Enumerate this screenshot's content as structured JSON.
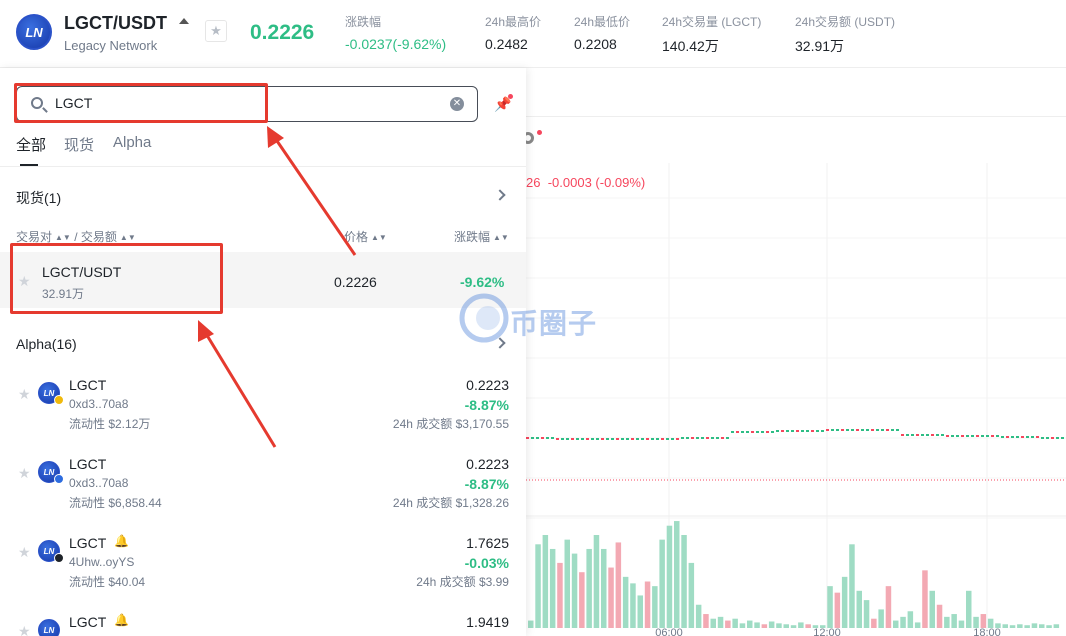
{
  "header": {
    "logo_text": "LN",
    "pair": "LGCT/USDT",
    "project": "Legacy Network",
    "price": "0.2226",
    "stats": [
      {
        "label": "涨跌幅",
        "value": "-0.0237(-9.62%)",
        "green": true
      },
      {
        "label": "24h最高价",
        "value": "0.2482"
      },
      {
        "label": "24h最低价",
        "value": "0.2208"
      },
      {
        "label": "24h交易量 (LGCT)",
        "value": "140.42万"
      },
      {
        "label": "24h交易额 (USDT)",
        "value": "32.91万"
      }
    ]
  },
  "search": {
    "value": "LGCT",
    "clear_icon": "clear-icon"
  },
  "tabs": [
    {
      "label": "全部",
      "active": true
    },
    {
      "label": "现货",
      "active": false
    },
    {
      "label": "Alpha",
      "active": false
    }
  ],
  "spot_section": {
    "title": "现货(1)"
  },
  "columns": {
    "pair": "交易对",
    "sep": "/",
    "volume": "交易额",
    "price": "价格",
    "change": "涨跌幅"
  },
  "spot_row": {
    "pair": "LGCT/USDT",
    "volume": "32.91万",
    "price": "0.2226",
    "change": "-9.62%"
  },
  "alpha_section": {
    "title": "Alpha(16)"
  },
  "alpha_rows": [
    {
      "name": "LGCT",
      "addr": "0xd3..70a8",
      "liquidity": "流动性 $2.12万",
      "price": "0.2223",
      "change": "-8.87%",
      "vol": "24h 成交额 $3,170.55",
      "chain_color": "#f0b90b",
      "bell": false
    },
    {
      "name": "LGCT",
      "addr": "0xd3..70a8",
      "liquidity": "流动性 $6,858.44",
      "price": "0.2223",
      "change": "-8.87%",
      "vol": "24h 成交额 $1,328.26",
      "chain_color": "#2d6cdf",
      "bell": false
    },
    {
      "name": "LGCT",
      "addr": "4Uhw..oyYS",
      "liquidity": "流动性 $40.04",
      "price": "1.7625",
      "change": "-0.03%",
      "vol": "24h 成交额 $3.99",
      "chain_color": "#1e2329",
      "bell": true
    },
    {
      "name": "LGCT",
      "addr": "",
      "liquidity": "",
      "price": "1.9419",
      "change": "",
      "vol": "",
      "chain_color": "#1e2329",
      "bell": true
    }
  ],
  "chart": {
    "ohlc_prefix": "26",
    "ohlc_change": "-0.0003 (-0.09%)",
    "time_labels": [
      "06:00",
      "12:00",
      "18:00"
    ],
    "watermark": "币圈子",
    "volume_bars": [
      {
        "v": 8,
        "up": true
      },
      {
        "v": 90,
        "up": true
      },
      {
        "v": 100,
        "up": true
      },
      {
        "v": 85,
        "up": true
      },
      {
        "v": 70,
        "up": false
      },
      {
        "v": 95,
        "up": true
      },
      {
        "v": 80,
        "up": true
      },
      {
        "v": 60,
        "up": false
      },
      {
        "v": 85,
        "up": true
      },
      {
        "v": 100,
        "up": true
      },
      {
        "v": 85,
        "up": true
      },
      {
        "v": 65,
        "up": false
      },
      {
        "v": 92,
        "up": false
      },
      {
        "v": 55,
        "up": true
      },
      {
        "v": 48,
        "up": true
      },
      {
        "v": 35,
        "up": true
      },
      {
        "v": 50,
        "up": false
      },
      {
        "v": 45,
        "up": true
      },
      {
        "v": 95,
        "up": true
      },
      {
        "v": 110,
        "up": true
      },
      {
        "v": 115,
        "up": true
      },
      {
        "v": 100,
        "up": true
      },
      {
        "v": 70,
        "up": true
      },
      {
        "v": 25,
        "up": true
      },
      {
        "v": 15,
        "up": false
      },
      {
        "v": 10,
        "up": true
      },
      {
        "v": 12,
        "up": true
      },
      {
        "v": 8,
        "up": false
      },
      {
        "v": 10,
        "up": true
      },
      {
        "v": 5,
        "up": true
      },
      {
        "v": 8,
        "up": true
      },
      {
        "v": 6,
        "up": true
      },
      {
        "v": 4,
        "up": false
      },
      {
        "v": 7,
        "up": true
      },
      {
        "v": 5,
        "up": true
      },
      {
        "v": 4,
        "up": true
      },
      {
        "v": 3,
        "up": true
      },
      {
        "v": 6,
        "up": true
      },
      {
        "v": 4,
        "up": false
      },
      {
        "v": 3,
        "up": true
      },
      {
        "v": 3,
        "up": true
      },
      {
        "v": 45,
        "up": true
      },
      {
        "v": 38,
        "up": false
      },
      {
        "v": 55,
        "up": true
      },
      {
        "v": 90,
        "up": true
      },
      {
        "v": 40,
        "up": true
      },
      {
        "v": 30,
        "up": true
      },
      {
        "v": 10,
        "up": false
      },
      {
        "v": 20,
        "up": true
      },
      {
        "v": 45,
        "up": false
      },
      {
        "v": 8,
        "up": true
      },
      {
        "v": 12,
        "up": true
      },
      {
        "v": 18,
        "up": true
      },
      {
        "v": 6,
        "up": true
      },
      {
        "v": 62,
        "up": false
      },
      {
        "v": 40,
        "up": true
      },
      {
        "v": 25,
        "up": false
      },
      {
        "v": 12,
        "up": true
      },
      {
        "v": 15,
        "up": true
      },
      {
        "v": 8,
        "up": true
      },
      {
        "v": 40,
        "up": true
      },
      {
        "v": 12,
        "up": true
      },
      {
        "v": 15,
        "up": false
      },
      {
        "v": 10,
        "up": true
      },
      {
        "v": 5,
        "up": true
      },
      {
        "v": 4,
        "up": true
      },
      {
        "v": 3,
        "up": true
      },
      {
        "v": 4,
        "up": true
      },
      {
        "v": 3,
        "up": true
      },
      {
        "v": 5,
        "up": true
      },
      {
        "v": 4,
        "up": true
      },
      {
        "v": 3,
        "up": true
      },
      {
        "v": 4,
        "up": true
      }
    ]
  }
}
